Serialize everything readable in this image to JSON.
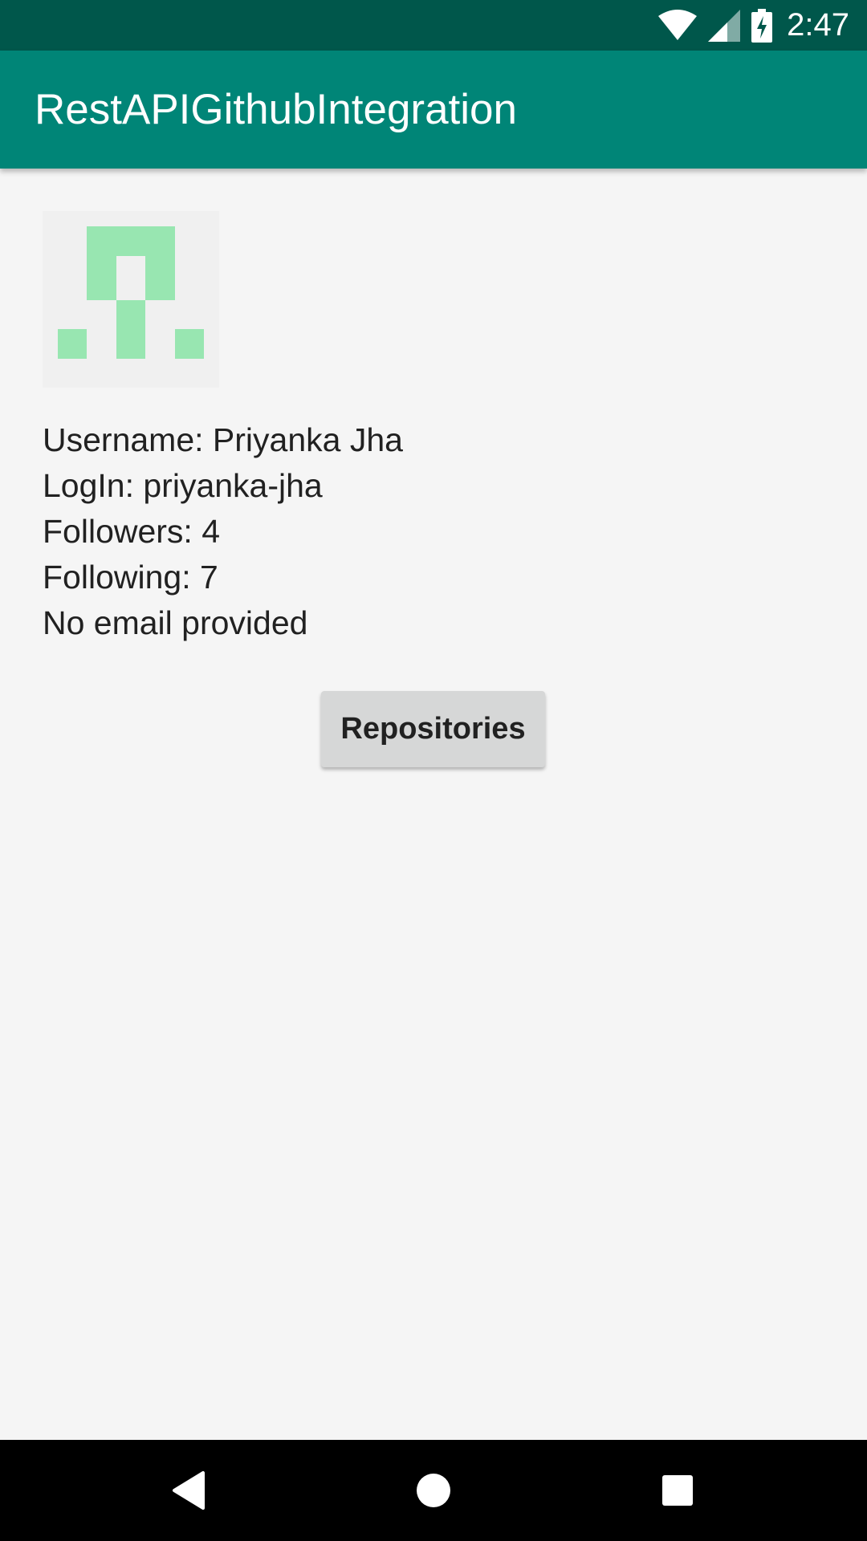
{
  "status_bar": {
    "time": "2:47",
    "icons": [
      "wifi-icon",
      "cell-signal-icon",
      "battery-charging-icon"
    ]
  },
  "app_bar": {
    "title": "RestAPIGithubIntegration"
  },
  "profile": {
    "avatar_icon": "identicon-avatar",
    "avatar_color": "#98e6b1",
    "username_line": "Username: Priyanka Jha",
    "login_line": "LogIn: priyanka-jha",
    "followers_line": "Followers: 4",
    "following_line": "Following: 7",
    "email_line": "No email provided"
  },
  "actions": {
    "repositories_label": "Repositories"
  },
  "nav_bar": {
    "icons": [
      "back-icon",
      "home-icon",
      "recents-icon"
    ]
  },
  "colors": {
    "status_bar": "#00574b",
    "app_bar": "#008577",
    "background": "#f5f5f5"
  }
}
